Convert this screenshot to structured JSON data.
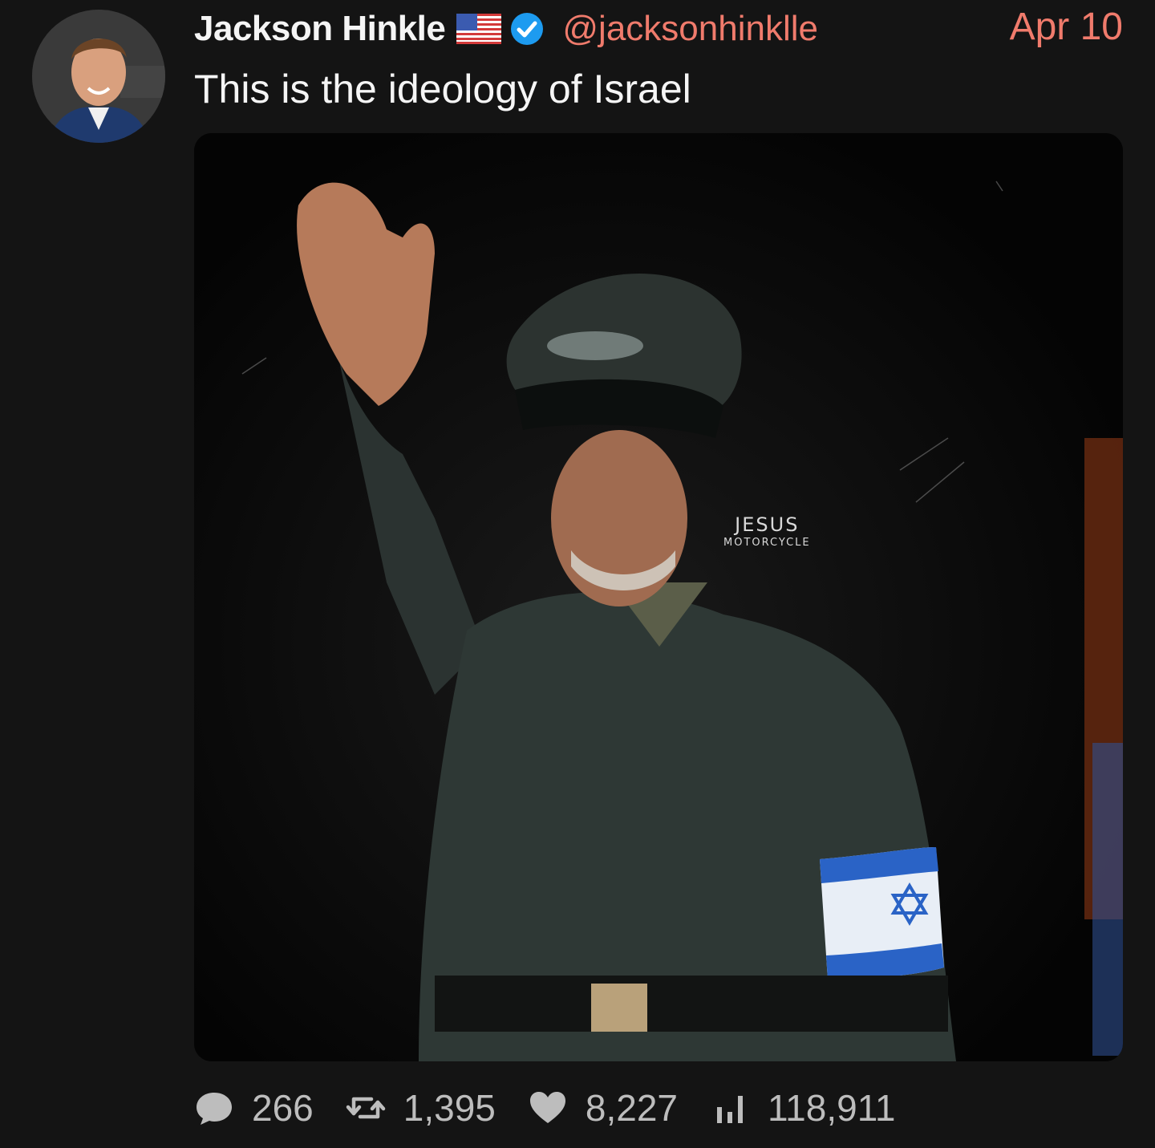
{
  "tweet": {
    "author": {
      "display_name": "Jackson Hinkle",
      "handle": "@jacksonhinkllе",
      "flag_icon": "us-flag-icon",
      "verified_icon": "verified-badge-icon",
      "avatar_icon": "avatar-photo"
    },
    "date": "Apr 10",
    "text": "This is the ideology of Israel",
    "media": {
      "watermark_line1": "JESUS",
      "watermark_line2": "MOTORCYCLE"
    },
    "actions": {
      "replies": {
        "icon": "comment-icon",
        "count": "266"
      },
      "retweets": {
        "icon": "retweet-icon",
        "count": "1,395"
      },
      "likes": {
        "icon": "heart-icon",
        "count": "8,227"
      },
      "views": {
        "icon": "views-chart-icon",
        "count": "118,911"
      }
    }
  },
  "colors": {
    "background": "#141414",
    "accent": "#f07b6c",
    "muted": "#bdbdbd",
    "verified": "#1d9bf0"
  }
}
